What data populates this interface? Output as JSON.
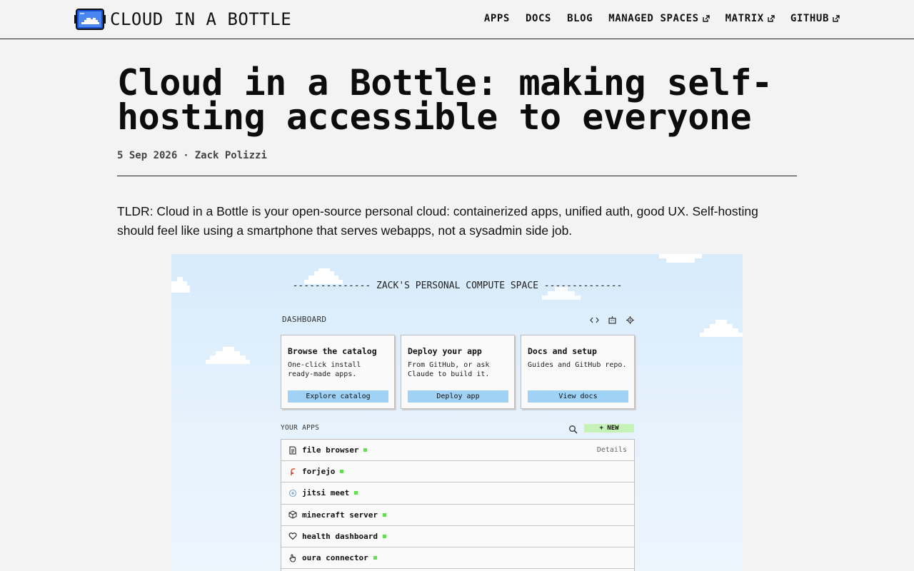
{
  "header": {
    "brand": "CLOUD IN A BOTTLE",
    "nav": [
      {
        "label": "APPS",
        "external": false
      },
      {
        "label": "DOCS",
        "external": false
      },
      {
        "label": "BLOG",
        "external": false
      },
      {
        "label": "MANAGED SPACES",
        "external": true
      },
      {
        "label": "MATRIX",
        "external": true
      },
      {
        "label": "GITHUB",
        "external": true
      }
    ]
  },
  "article": {
    "title": "Cloud in a Bottle: making self-hosting accessible to everyone",
    "date": "5 Sep 2026",
    "separator": "·",
    "author": "Zack Polizzi",
    "lead": "TLDR: Cloud in a Bottle is your open-source personal cloud: containerized apps, unified auth, good UX. Self-hosting should feel like using a smartphone that serves webapps, not a sysadmin side job."
  },
  "screenshot": {
    "title": "-------------- ZACK'S PERSONAL COMPUTE SPACE --------------",
    "dashboard_label": "DASHBOARD",
    "dashboard_icons": [
      "code-icon",
      "robot-icon",
      "gear-icon"
    ],
    "cards": [
      {
        "title": "Browse the catalog",
        "desc": "One-click install ready-made apps.",
        "button": "Explore catalog"
      },
      {
        "title": "Deploy your app",
        "desc": "From GitHub, or ask Claude to build it.",
        "button": "Deploy app"
      },
      {
        "title": "Docs and setup",
        "desc": "Guides and GitHub repo.",
        "button": "View docs"
      }
    ],
    "apps_label": "YOUR APPS",
    "new_button": "+ NEW",
    "details_label": "Details",
    "apps": [
      {
        "name": "file browser",
        "icon": "file-icon",
        "status": "running"
      },
      {
        "name": "forjejo",
        "icon": "forgejo-icon",
        "status": "running"
      },
      {
        "name": "jitsi meet",
        "icon": "jitsi-icon",
        "status": "running"
      },
      {
        "name": "minecraft server",
        "icon": "cube-icon",
        "status": "running"
      },
      {
        "name": "health dashboard",
        "icon": "heart-icon",
        "status": "running"
      },
      {
        "name": "oura connector",
        "icon": "hand-icon",
        "status": "running"
      }
    ]
  },
  "colors": {
    "page_bg": "#f3f3f3",
    "text": "#111111",
    "card_button": "#9fd2f5",
    "new_button": "#c6f2b7",
    "status_dot": "#5fe04c",
    "sky_top": "#d7ebfb"
  }
}
